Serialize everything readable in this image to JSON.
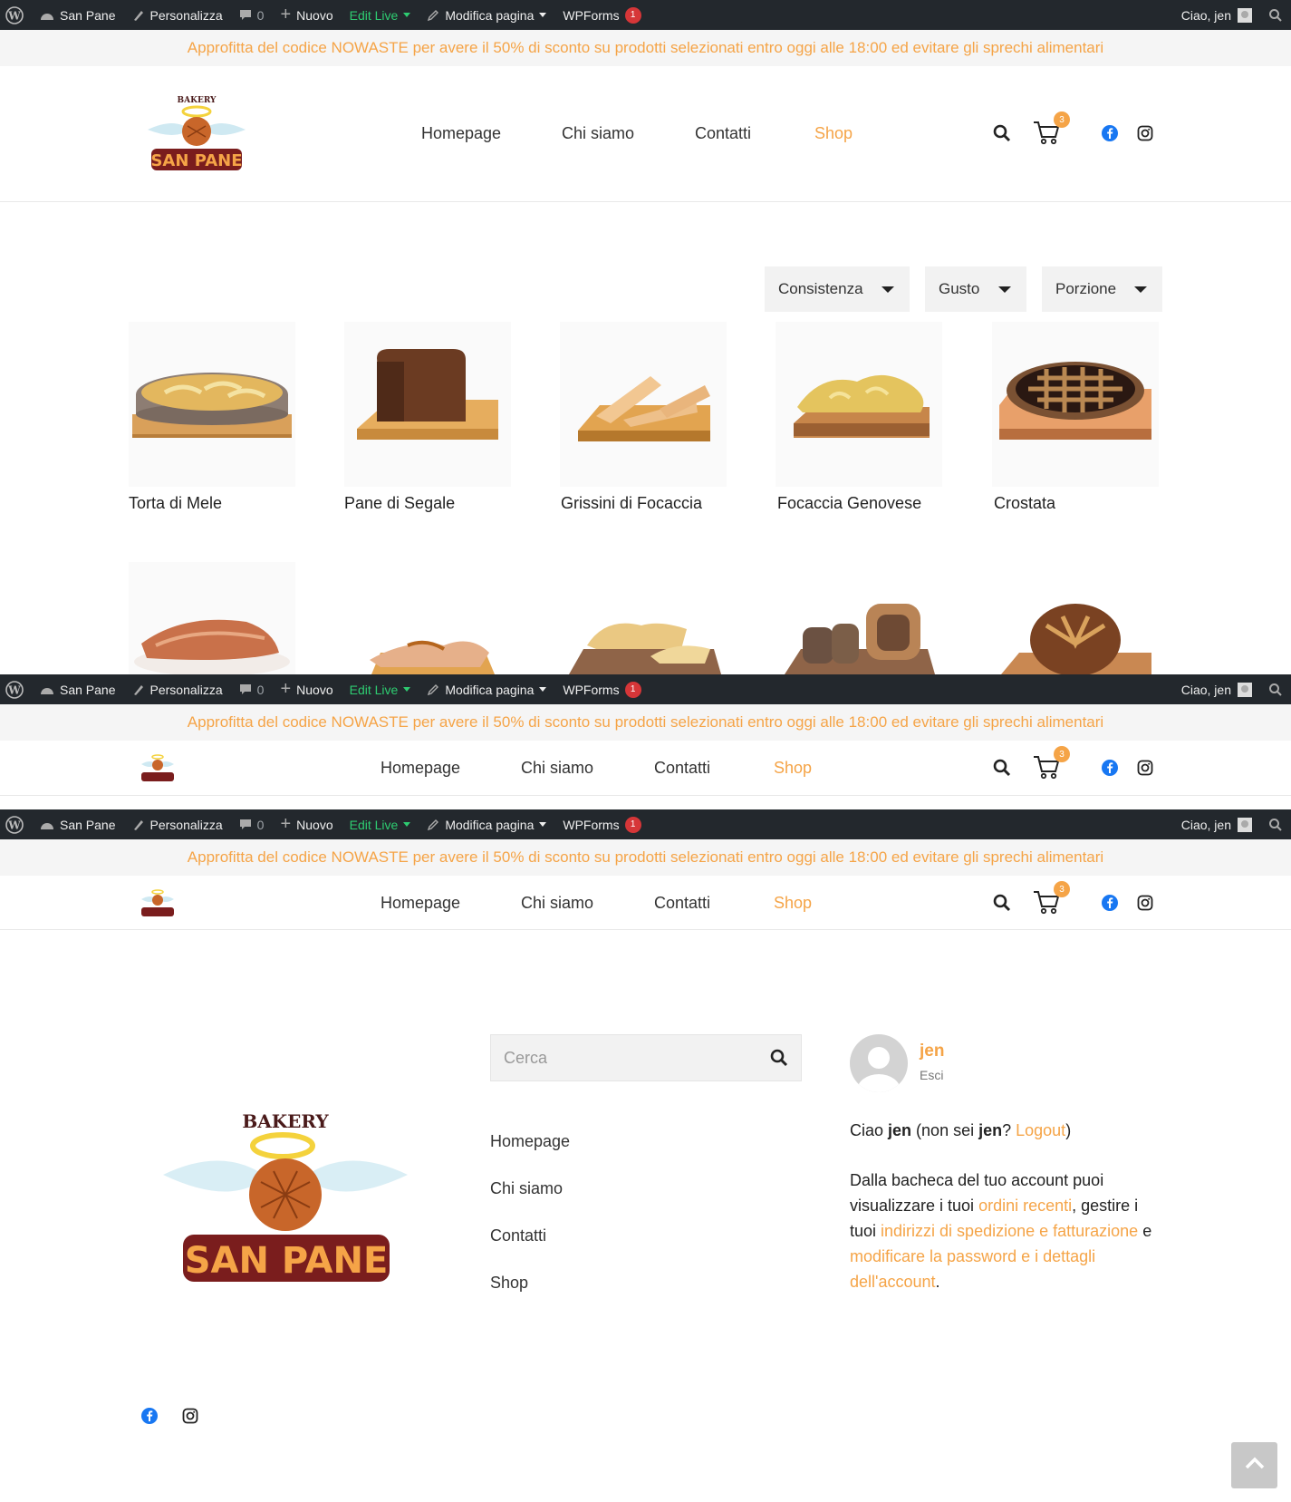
{
  "admin_bar": {
    "site_name": "San Pane",
    "customize": "Personalizza",
    "comments_count": "0",
    "new": "Nuovo",
    "edit_live": "Edit Live",
    "edit_page": "Modifica pagina",
    "wpforms": "WPForms",
    "wpforms_badge": "1",
    "greeting": "Ciao, jen"
  },
  "promo": {
    "text": "Approfitta del codice NOWASTE per avere il 50% di sconto su prodotti selezionati entro oggi alle 18:00 ed evitare gli sprechi alimentari"
  },
  "logo": {
    "top_text": "BAKERY",
    "brand": "SAN PANE"
  },
  "nav": {
    "items": [
      "Homepage",
      "Chi siamo",
      "Contatti",
      "Shop"
    ],
    "active": "Shop",
    "cart_count": "3"
  },
  "filters": [
    "Consistenza",
    "Gusto",
    "Porzione"
  ],
  "products": [
    {
      "name": "Torta di Mele",
      "icon": "apple-cake-icon"
    },
    {
      "name": "Pane di Segale",
      "icon": "rye-bread-icon"
    },
    {
      "name": "Grissini di Focaccia",
      "icon": "focaccia-sticks-icon"
    },
    {
      "name": "Focaccia Genovese",
      "icon": "focaccia-icon"
    },
    {
      "name": "Crostata",
      "icon": "tart-icon"
    }
  ],
  "footer": {
    "search_placeholder": "Cerca",
    "links": [
      "Homepage",
      "Chi siamo",
      "Contatti",
      "Shop"
    ],
    "user": {
      "name": "jen",
      "logout_label": "Esci"
    },
    "account": {
      "hello_prefix": "Ciao ",
      "hello_name": "jen",
      "hello_middle": " (non sei ",
      "hello_name2": "jen",
      "hello_q": "? ",
      "logout_link": "Logout",
      "hello_end": ")",
      "desc_1": "Dalla bacheca del tuo account puoi visualizzare i tuoi ",
      "link_orders": "ordini recenti",
      "desc_2": ", gestire i tuoi ",
      "link_addresses": "indirizzi di spedizione e fatturazione",
      "desc_3": " e ",
      "link_password": "modificare la password e i dettagli dell'account",
      "desc_4": "."
    }
  },
  "colors": {
    "accent": "#f5a447",
    "admin_bar": "#23282d",
    "logo_red": "#7a1d1d",
    "facebook": "#1877f2"
  }
}
